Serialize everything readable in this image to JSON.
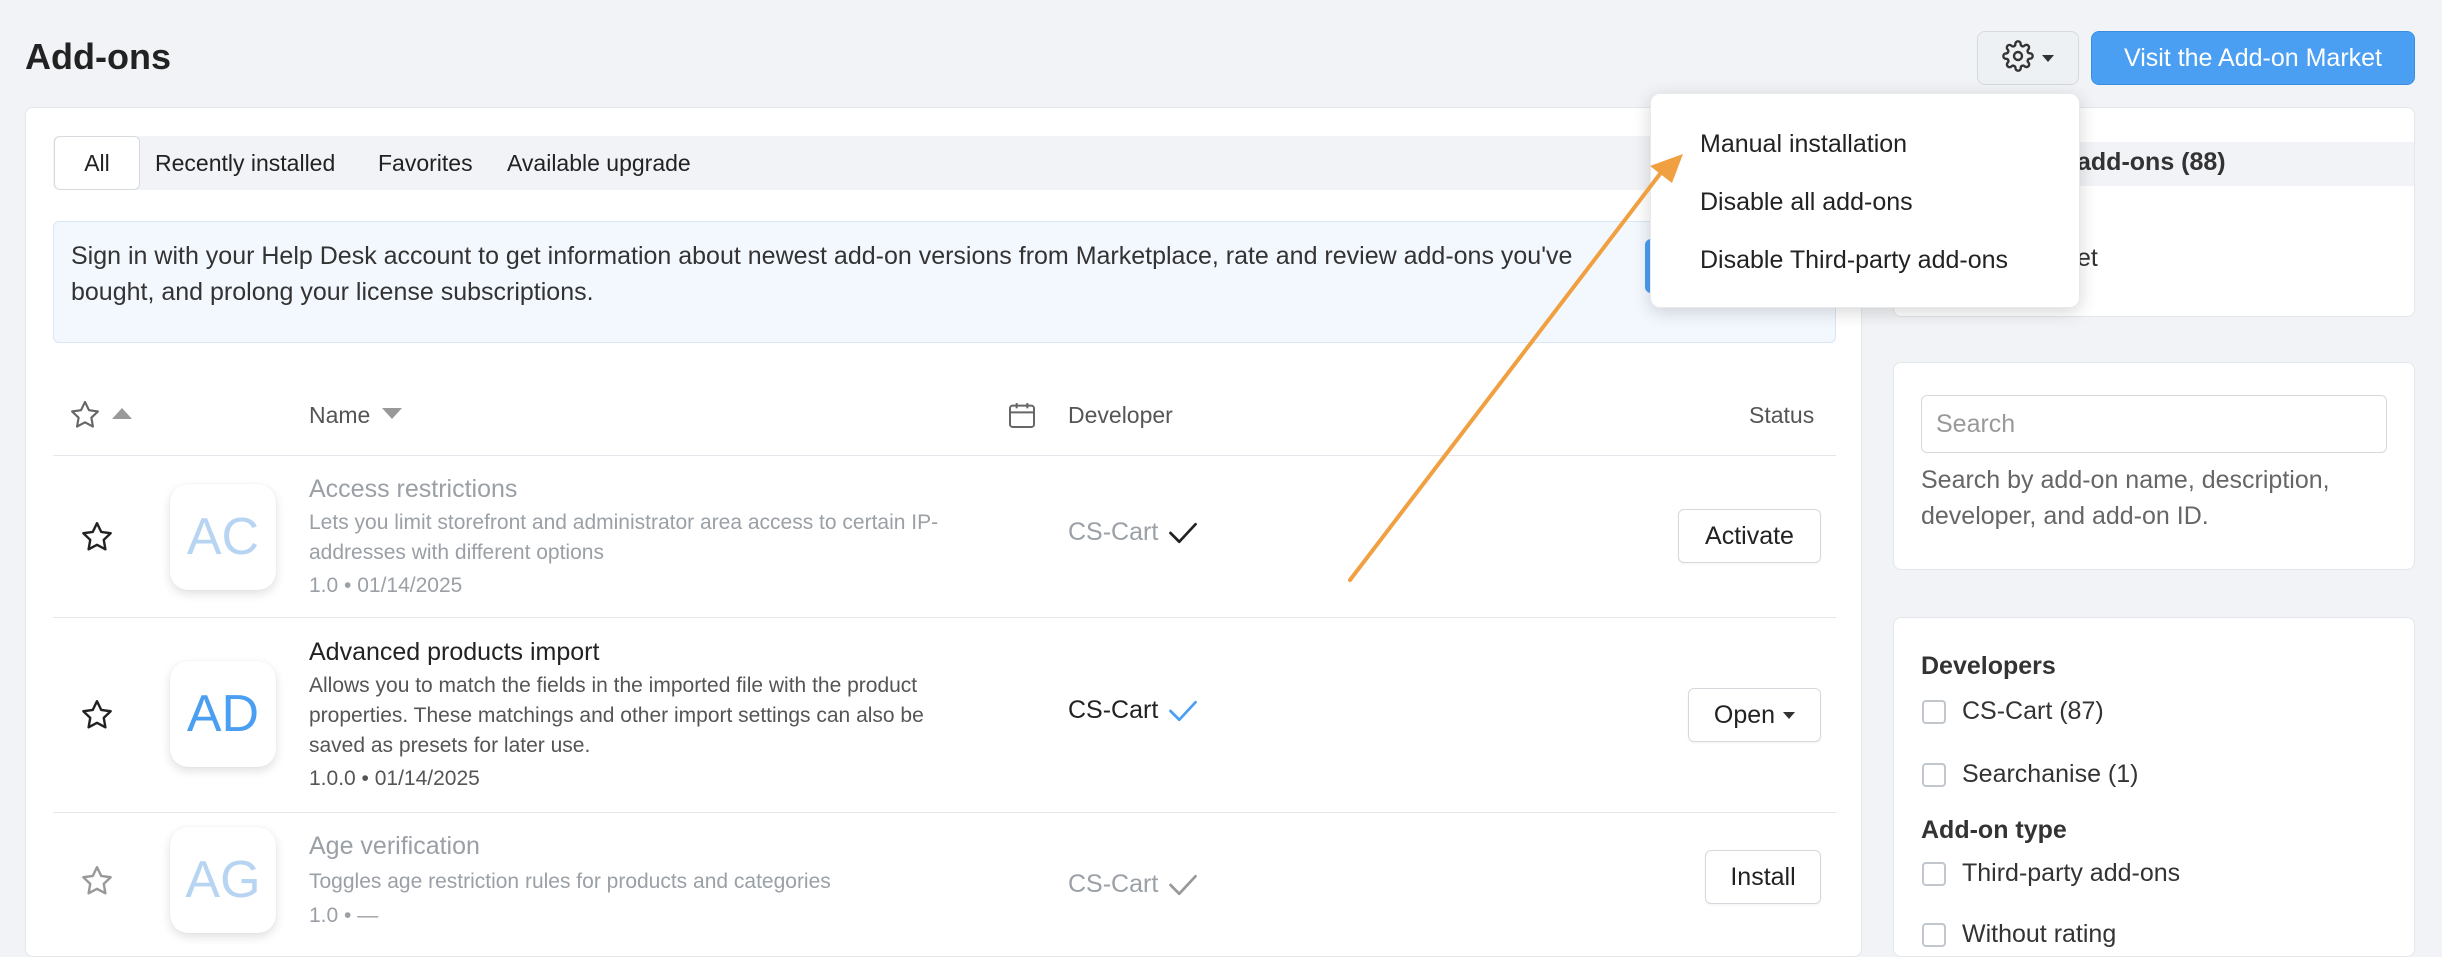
{
  "header": {
    "title": "Add-ons",
    "market_button": "Visit the Add-on Market"
  },
  "tabs": [
    {
      "label": "All",
      "active": true
    },
    {
      "label": "Recently installed"
    },
    {
      "label": "Favorites"
    },
    {
      "label": "Available upgrade"
    }
  ],
  "signin_notice": "Sign in with your Help Desk account to get information about newest add-on versions from Marketplace, rate and review add-ons you've bought, and prolong your license subscriptions.",
  "table": {
    "headers": {
      "name": "Name",
      "developer": "Developer",
      "status": "Status"
    },
    "rows": [
      {
        "initials": "AC",
        "name": "Access restrictions",
        "description": "Lets you limit storefront and administrator area access to certain IP-addresses with different options",
        "meta": "1.0 • 01/14/2025",
        "developer": "CS-Cart",
        "action": "Activate",
        "state": "disabled"
      },
      {
        "initials": "AD",
        "name": "Advanced products import",
        "description": "Allows you to match the fields in the imported file with the product properties. These matchings and other import settings can also be saved as presets for later use.",
        "meta": "1.0.0 • 01/14/2025",
        "developer": "CS-Cart",
        "action": "Open",
        "state": "active"
      },
      {
        "initials": "AG",
        "name": "Age verification",
        "description": "Toggles age restriction rules for products and categories",
        "meta": "1.0 • —",
        "developer": "CS-Cart",
        "action": "Install",
        "state": "not_installed"
      }
    ]
  },
  "sidebar": {
    "summary_title": "add-ons (88)",
    "summary_item": "et",
    "search_placeholder": "Search",
    "search_hint": "Search by add-on name, description, developer, and add-on ID.",
    "developers_heading": "Developers",
    "developers": [
      "CS-Cart (87)",
      "Searchanise (1)"
    ],
    "addon_type_heading": "Add-on type",
    "addon_types": [
      "Third-party add-ons",
      "Without rating"
    ]
  },
  "settings_menu": {
    "items": [
      "Manual installation",
      "Disable all add-ons",
      "Disable Third-party add-ons"
    ]
  },
  "colors": {
    "accent": "#4b9ff2",
    "annotation_arrow": "#f0a040"
  }
}
